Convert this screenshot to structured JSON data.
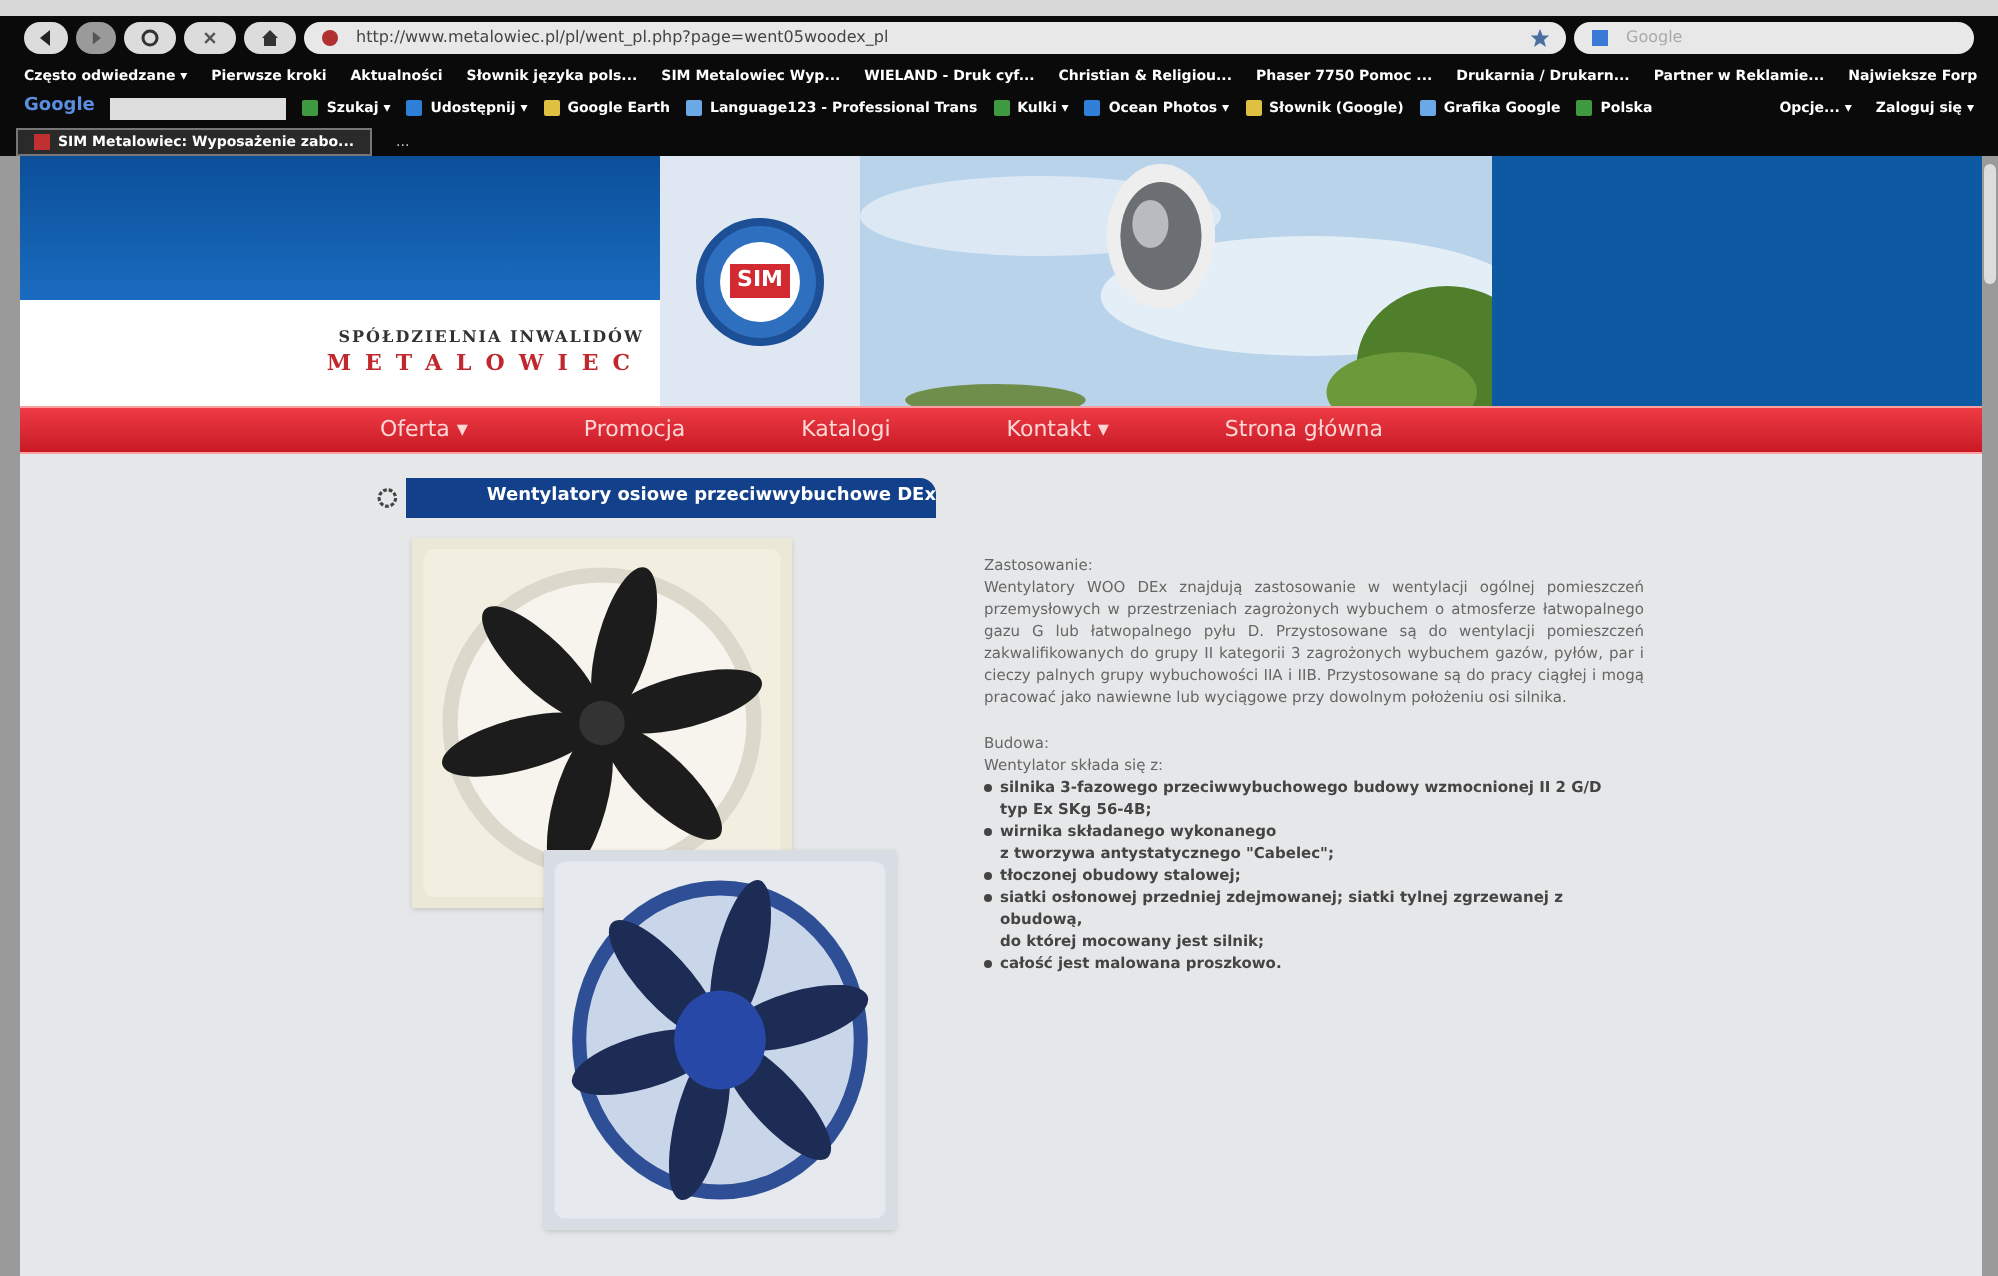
{
  "browser": {
    "url": "http://www.metalowiec.pl/pl/went_pl.php?page=went05woodex_pl",
    "search_placeholder": "Google",
    "bookmarks": [
      "Często odwiedzane ▾",
      "Pierwsze kroki",
      "Aktualności",
      "Słownik języka pols...",
      "SIM Metalowiec Wyp...",
      "WIELAND - Druk cyf...",
      "Christian & Religiou...",
      "Phaser 7750 Pomoc ...",
      "Drukarnia / Drukarn...",
      "Partner w Reklamie...",
      "Najwieksze Forp"
    ],
    "toolbar": {
      "logo": "Google",
      "items": [
        "Szukaj ▾",
        "Udostępnij ▾",
        "Google Earth",
        "Language123 - Professional Trans",
        "Kulki ▾",
        "Ocean Photos ▾",
        "Słownik (Google)",
        "Grafika Google",
        "Polska"
      ],
      "right_items": [
        "Opcje... ▾",
        "Zaloguj się ▾"
      ]
    },
    "tabs": [
      {
        "label": "SIM Metalowiec: Wyposażenie zabo...",
        "selected": true
      },
      {
        "label": "...",
        "selected": false
      }
    ]
  },
  "site": {
    "logo_text": "SIM",
    "company_line": "SPÓŁDZIELNIA INWALIDÓW",
    "company_name": "METALOWIEC",
    "nav": [
      "Oferta ▾",
      "Promocja",
      "Katalogi",
      "Kontakt ▾",
      "Strona główna"
    ],
    "heading": "Wentylatory osiowe przeciwwybuchowe DEx",
    "usage_title": "Zastosowanie:",
    "usage_text": "Wentylatory WOO DEx znajdują zastosowanie w wentylacji ogólnej pomieszczeń przemysłowych w przestrzeniach zagrożonych wybuchem o atmosferze łatwopalnego gazu G lub łatwopalnego pyłu D. Przystosowane są do wentylacji pomieszczeń zakwalifikowanych do grupy II kategorii 3 zagrożonych wybuchem gazów, pyłów, par i cieczy palnych grupy wybuchowości IIA i IIB. Przystosowane są do pracy ciągłej i mogą pracować jako nawiewne lub wyciągowe przy dowolnym położeniu osi silnika.",
    "build_title": "Budowa:",
    "build_intro": "Wentylator składa się z:",
    "build_items": [
      "silnika 3-fazowego przeciwwybuchowego budowy wzmocnionej II 2 G/D\ntyp Ex SKg 56-4B;",
      "wirnika składanego wykonanego\nz tworzywa antystatycznego \"Cabelec\";",
      "tłoczonej obudowy stalowej;",
      "siatki osłonowej przedniej zdejmowanej; siatki tylnej zgrzewanej z obudową,\ndo której mocowany jest silnik;",
      "całość jest malowana proszkowo."
    ]
  }
}
